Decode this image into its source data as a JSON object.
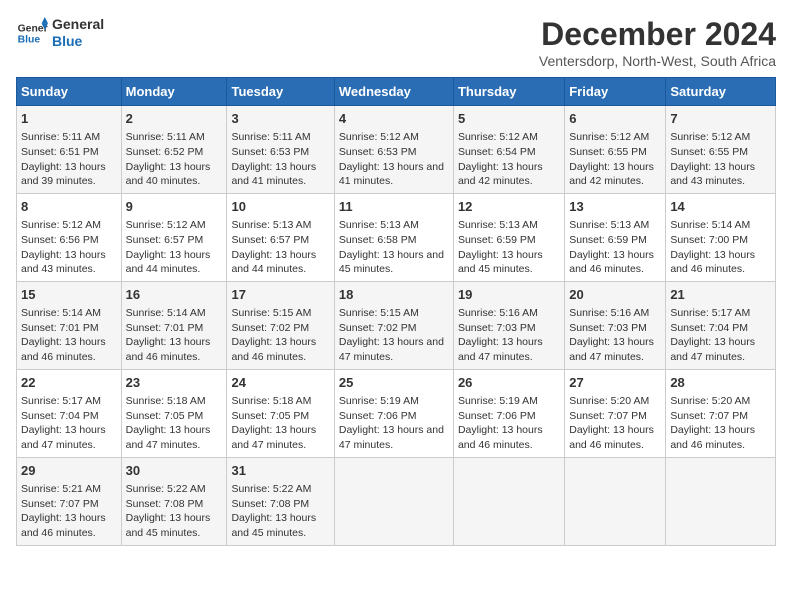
{
  "logo": {
    "line1": "General",
    "line2": "Blue"
  },
  "title": "December 2024",
  "subtitle": "Ventersdorp, North-West, South Africa",
  "days_of_week": [
    "Sunday",
    "Monday",
    "Tuesday",
    "Wednesday",
    "Thursday",
    "Friday",
    "Saturday"
  ],
  "weeks": [
    [
      {
        "day": "1",
        "sunrise": "Sunrise: 5:11 AM",
        "sunset": "Sunset: 6:51 PM",
        "daylight": "Daylight: 13 hours and 39 minutes."
      },
      {
        "day": "2",
        "sunrise": "Sunrise: 5:11 AM",
        "sunset": "Sunset: 6:52 PM",
        "daylight": "Daylight: 13 hours and 40 minutes."
      },
      {
        "day": "3",
        "sunrise": "Sunrise: 5:11 AM",
        "sunset": "Sunset: 6:53 PM",
        "daylight": "Daylight: 13 hours and 41 minutes."
      },
      {
        "day": "4",
        "sunrise": "Sunrise: 5:12 AM",
        "sunset": "Sunset: 6:53 PM",
        "daylight": "Daylight: 13 hours and 41 minutes."
      },
      {
        "day": "5",
        "sunrise": "Sunrise: 5:12 AM",
        "sunset": "Sunset: 6:54 PM",
        "daylight": "Daylight: 13 hours and 42 minutes."
      },
      {
        "day": "6",
        "sunrise": "Sunrise: 5:12 AM",
        "sunset": "Sunset: 6:55 PM",
        "daylight": "Daylight: 13 hours and 42 minutes."
      },
      {
        "day": "7",
        "sunrise": "Sunrise: 5:12 AM",
        "sunset": "Sunset: 6:55 PM",
        "daylight": "Daylight: 13 hours and 43 minutes."
      }
    ],
    [
      {
        "day": "8",
        "sunrise": "Sunrise: 5:12 AM",
        "sunset": "Sunset: 6:56 PM",
        "daylight": "Daylight: 13 hours and 43 minutes."
      },
      {
        "day": "9",
        "sunrise": "Sunrise: 5:12 AM",
        "sunset": "Sunset: 6:57 PM",
        "daylight": "Daylight: 13 hours and 44 minutes."
      },
      {
        "day": "10",
        "sunrise": "Sunrise: 5:13 AM",
        "sunset": "Sunset: 6:57 PM",
        "daylight": "Daylight: 13 hours and 44 minutes."
      },
      {
        "day": "11",
        "sunrise": "Sunrise: 5:13 AM",
        "sunset": "Sunset: 6:58 PM",
        "daylight": "Daylight: 13 hours and 45 minutes."
      },
      {
        "day": "12",
        "sunrise": "Sunrise: 5:13 AM",
        "sunset": "Sunset: 6:59 PM",
        "daylight": "Daylight: 13 hours and 45 minutes."
      },
      {
        "day": "13",
        "sunrise": "Sunrise: 5:13 AM",
        "sunset": "Sunset: 6:59 PM",
        "daylight": "Daylight: 13 hours and 46 minutes."
      },
      {
        "day": "14",
        "sunrise": "Sunrise: 5:14 AM",
        "sunset": "Sunset: 7:00 PM",
        "daylight": "Daylight: 13 hours and 46 minutes."
      }
    ],
    [
      {
        "day": "15",
        "sunrise": "Sunrise: 5:14 AM",
        "sunset": "Sunset: 7:01 PM",
        "daylight": "Daylight: 13 hours and 46 minutes."
      },
      {
        "day": "16",
        "sunrise": "Sunrise: 5:14 AM",
        "sunset": "Sunset: 7:01 PM",
        "daylight": "Daylight: 13 hours and 46 minutes."
      },
      {
        "day": "17",
        "sunrise": "Sunrise: 5:15 AM",
        "sunset": "Sunset: 7:02 PM",
        "daylight": "Daylight: 13 hours and 46 minutes."
      },
      {
        "day": "18",
        "sunrise": "Sunrise: 5:15 AM",
        "sunset": "Sunset: 7:02 PM",
        "daylight": "Daylight: 13 hours and 47 minutes."
      },
      {
        "day": "19",
        "sunrise": "Sunrise: 5:16 AM",
        "sunset": "Sunset: 7:03 PM",
        "daylight": "Daylight: 13 hours and 47 minutes."
      },
      {
        "day": "20",
        "sunrise": "Sunrise: 5:16 AM",
        "sunset": "Sunset: 7:03 PM",
        "daylight": "Daylight: 13 hours and 47 minutes."
      },
      {
        "day": "21",
        "sunrise": "Sunrise: 5:17 AM",
        "sunset": "Sunset: 7:04 PM",
        "daylight": "Daylight: 13 hours and 47 minutes."
      }
    ],
    [
      {
        "day": "22",
        "sunrise": "Sunrise: 5:17 AM",
        "sunset": "Sunset: 7:04 PM",
        "daylight": "Daylight: 13 hours and 47 minutes."
      },
      {
        "day": "23",
        "sunrise": "Sunrise: 5:18 AM",
        "sunset": "Sunset: 7:05 PM",
        "daylight": "Daylight: 13 hours and 47 minutes."
      },
      {
        "day": "24",
        "sunrise": "Sunrise: 5:18 AM",
        "sunset": "Sunset: 7:05 PM",
        "daylight": "Daylight: 13 hours and 47 minutes."
      },
      {
        "day": "25",
        "sunrise": "Sunrise: 5:19 AM",
        "sunset": "Sunset: 7:06 PM",
        "daylight": "Daylight: 13 hours and 47 minutes."
      },
      {
        "day": "26",
        "sunrise": "Sunrise: 5:19 AM",
        "sunset": "Sunset: 7:06 PM",
        "daylight": "Daylight: 13 hours and 46 minutes."
      },
      {
        "day": "27",
        "sunrise": "Sunrise: 5:20 AM",
        "sunset": "Sunset: 7:07 PM",
        "daylight": "Daylight: 13 hours and 46 minutes."
      },
      {
        "day": "28",
        "sunrise": "Sunrise: 5:20 AM",
        "sunset": "Sunset: 7:07 PM",
        "daylight": "Daylight: 13 hours and 46 minutes."
      }
    ],
    [
      {
        "day": "29",
        "sunrise": "Sunrise: 5:21 AM",
        "sunset": "Sunset: 7:07 PM",
        "daylight": "Daylight: 13 hours and 46 minutes."
      },
      {
        "day": "30",
        "sunrise": "Sunrise: 5:22 AM",
        "sunset": "Sunset: 7:08 PM",
        "daylight": "Daylight: 13 hours and 45 minutes."
      },
      {
        "day": "31",
        "sunrise": "Sunrise: 5:22 AM",
        "sunset": "Sunset: 7:08 PM",
        "daylight": "Daylight: 13 hours and 45 minutes."
      },
      null,
      null,
      null,
      null
    ]
  ]
}
